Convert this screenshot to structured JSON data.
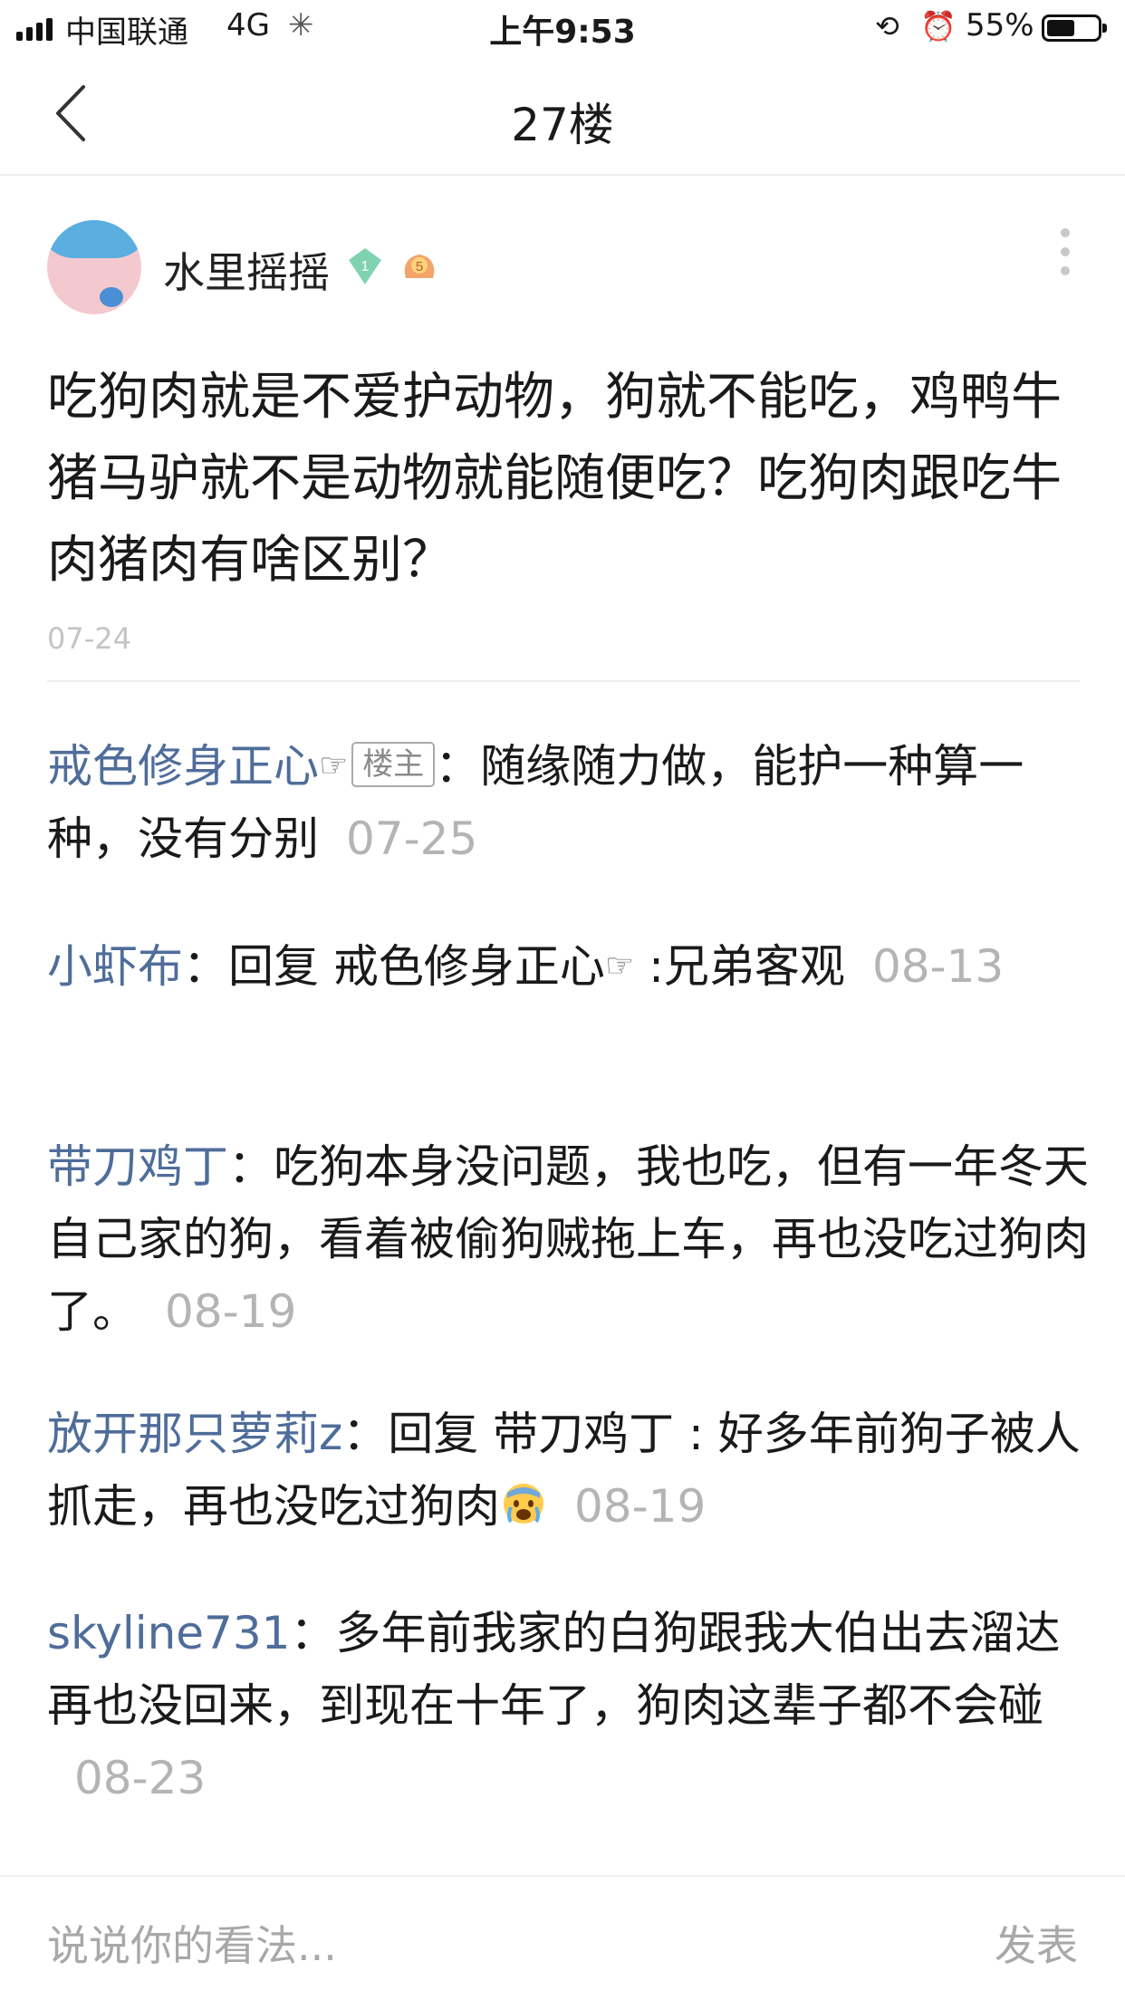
{
  "status_bar": {
    "carrier": "中国联通",
    "network": "4G",
    "time": "上午9:53",
    "battery": "55%",
    "battery_level": 0.55
  },
  "nav": {
    "title": "27楼"
  },
  "post": {
    "author": "水里摇摇",
    "level_badge": "1",
    "member_badge": "5",
    "content": "吃狗肉就是不爱护动物，狗就不能吃，鸡鸭牛猪马驴就不是动物就能随便吃？吃狗肉跟吃牛肉猪肉有啥区别？",
    "date": "07-24"
  },
  "replies": [
    {
      "name": "戒色修身正心",
      "hand": "☞",
      "tag": "楼主",
      "sep": "：",
      "text": "随缘随力做，能护一种算一种，没有分别",
      "date": "07-25"
    },
    {
      "name": "小虾布",
      "sep": "：",
      "text_before": "回复 戒色修身正心",
      "hand": "☞",
      "text_after": " :兄弟客观",
      "date": "08-13"
    },
    {
      "name": "带刀鸡丁",
      "sep": "：",
      "text": "吃狗本身没问题，我也吃，但有一年冬天自己家的狗，看着被偷狗贼拖上车，再也没吃过狗肉了。",
      "date": "08-19"
    },
    {
      "name": "放开那只萝莉z",
      "sep": "：",
      "text": "回复 带刀鸡丁 : 好多年前狗子被人抓走，再也没吃过狗肉",
      "emoji": "crying-face",
      "date": "08-19"
    },
    {
      "name": "skyline731",
      "sep": "：",
      "text": "多年前我家的白狗跟我大伯出去溜达再也没回来，到现在十年了，狗肉这辈子都不会碰",
      "date": "08-23"
    }
  ],
  "footer": {
    "input_placeholder": "说说你的看法...",
    "publish_label": "发表"
  }
}
